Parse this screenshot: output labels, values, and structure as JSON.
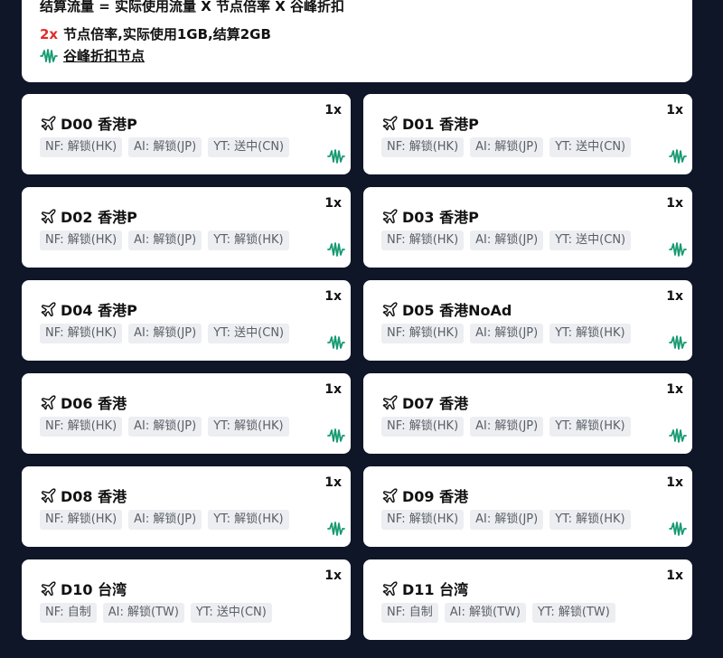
{
  "info": {
    "formula": "结算流量 = 实际使用流量 X 节点倍率 X 谷峰折扣",
    "example_mult": "2x",
    "example_text": "节点倍率,实际使用1GB,结算2GB",
    "valley_link": "谷峰折扣节点"
  },
  "colors": {
    "background": "#0e1628",
    "accent_red": "#e32b2b",
    "wave_green": "#169a72"
  },
  "nodes": [
    {
      "name": "D00 香港P",
      "rate": "1x",
      "tags": [
        "NF: 解锁(HK)",
        "AI: 解锁(JP)",
        "YT: 送中(CN)"
      ],
      "valley": true
    },
    {
      "name": "D01 香港P",
      "rate": "1x",
      "tags": [
        "NF: 解锁(HK)",
        "AI: 解锁(JP)",
        "YT: 送中(CN)"
      ],
      "valley": true
    },
    {
      "name": "D02 香港P",
      "rate": "1x",
      "tags": [
        "NF: 解锁(HK)",
        "AI: 解锁(JP)",
        "YT: 解锁(HK)"
      ],
      "valley": true
    },
    {
      "name": "D03 香港P",
      "rate": "1x",
      "tags": [
        "NF: 解锁(HK)",
        "AI: 解锁(JP)",
        "YT: 送中(CN)"
      ],
      "valley": true
    },
    {
      "name": "D04 香港P",
      "rate": "1x",
      "tags": [
        "NF: 解锁(HK)",
        "AI: 解锁(JP)",
        "YT: 送中(CN)"
      ],
      "valley": true
    },
    {
      "name": "D05 香港NoAd",
      "rate": "1x",
      "tags": [
        "NF: 解锁(HK)",
        "AI: 解锁(JP)",
        "YT: 解锁(HK)"
      ],
      "valley": true
    },
    {
      "name": "D06 香港",
      "rate": "1x",
      "tags": [
        "NF: 解锁(HK)",
        "AI: 解锁(JP)",
        "YT: 解锁(HK)"
      ],
      "valley": true
    },
    {
      "name": "D07 香港",
      "rate": "1x",
      "tags": [
        "NF: 解锁(HK)",
        "AI: 解锁(JP)",
        "YT: 解锁(HK)"
      ],
      "valley": true
    },
    {
      "name": "D08 香港",
      "rate": "1x",
      "tags": [
        "NF: 解锁(HK)",
        "AI: 解锁(JP)",
        "YT: 解锁(HK)"
      ],
      "valley": true
    },
    {
      "name": "D09 香港",
      "rate": "1x",
      "tags": [
        "NF: 解锁(HK)",
        "AI: 解锁(JP)",
        "YT: 解锁(HK)"
      ],
      "valley": true
    },
    {
      "name": "D10 台湾",
      "rate": "1x",
      "tags": [
        "NF: 自制",
        "AI: 解锁(TW)",
        "YT: 送中(CN)"
      ],
      "valley": false
    },
    {
      "name": "D11 台湾",
      "rate": "1x",
      "tags": [
        "NF: 自制",
        "AI: 解锁(TW)",
        "YT: 解锁(TW)"
      ],
      "valley": false
    }
  ]
}
